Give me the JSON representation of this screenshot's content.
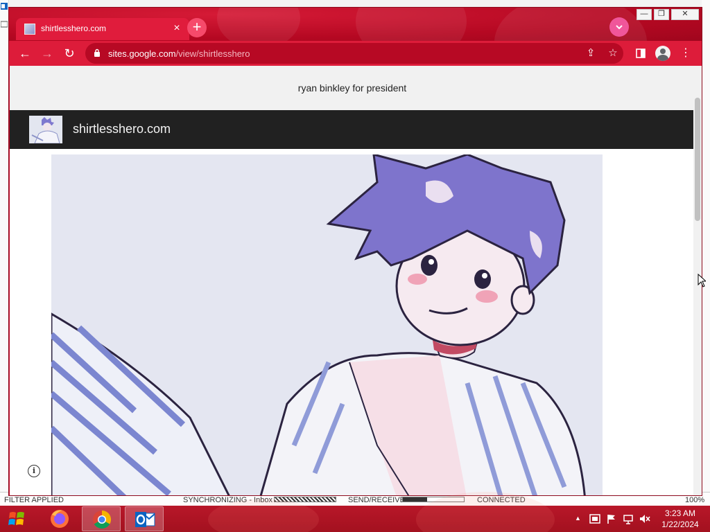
{
  "browser": {
    "tab": {
      "title": "shirtlesshero.com",
      "close": "×"
    },
    "new_tab": "+",
    "tab_search": "⌄",
    "window_controls": {
      "minimize": "—",
      "maximize": "❐",
      "close": "✕"
    },
    "nav": {
      "back": "←",
      "forward": "→",
      "reload": "↻"
    },
    "address": {
      "domain": "sites.google.com",
      "path": "/view/shirtlesshero"
    },
    "toolbar_icons": {
      "share": "⇪",
      "bookmark": "☆",
      "side_panel": "▮",
      "menu": "⋮"
    }
  },
  "page": {
    "announcement": "ryan binkley for president",
    "site_title": "shirtlesshero.com",
    "info_button": "i"
  },
  "outlook_status": {
    "filter": "FILTER APPLIED",
    "sync": "SYNCHRONIZING - Inbox",
    "send_receive": "SEND/RECEIVE",
    "connection": "CONNECTED",
    "zoom": "100%"
  },
  "taskbar": {
    "apps": [
      "firefox",
      "chrome",
      "outlook"
    ],
    "time": "3:23 AM",
    "date": "1/22/2024"
  },
  "colors": {
    "chrome_frame": "#c40c2a",
    "chrome_toolbar": "#dd1c3a",
    "site_header": "#212121",
    "taskbar": "#b81729"
  }
}
